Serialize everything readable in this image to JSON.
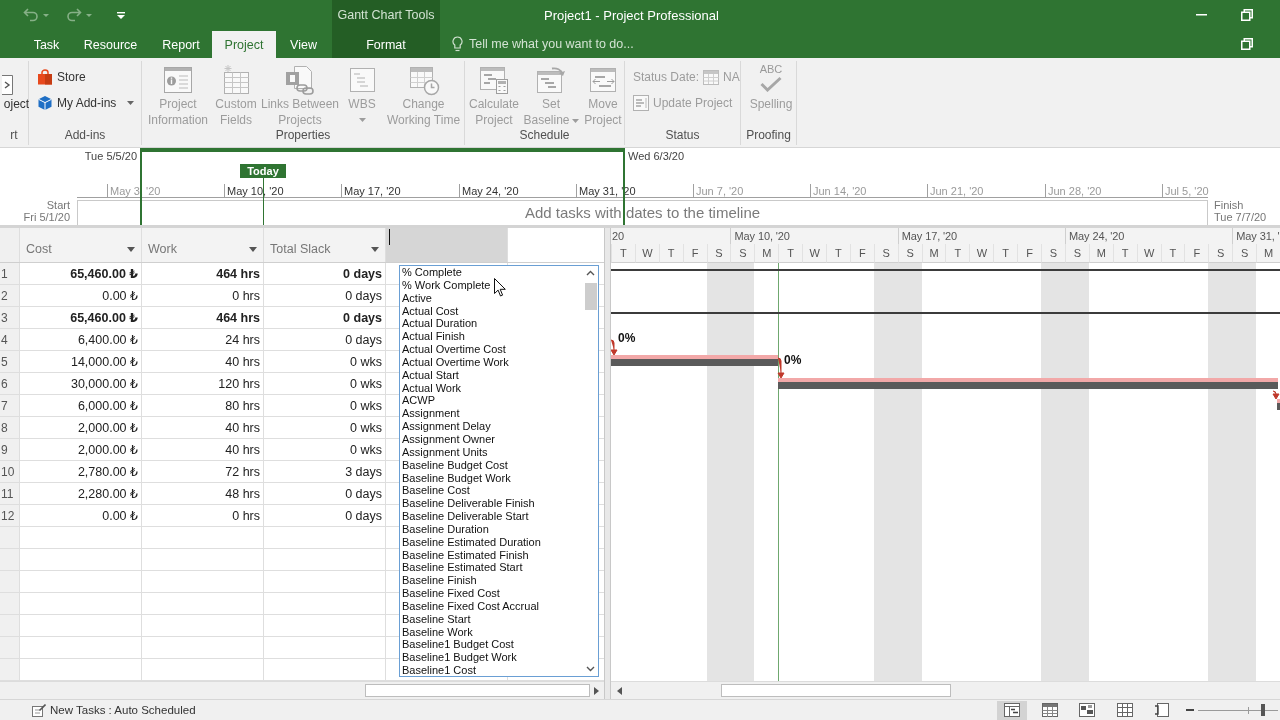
{
  "header": {
    "title": "Project1 - Project Professional",
    "context_group": "Gantt Chart Tools",
    "tabs": [
      {
        "label": "Task",
        "kind": "standard",
        "selected": false
      },
      {
        "label": "Resource",
        "kind": "standard",
        "selected": false
      },
      {
        "label": "Report",
        "kind": "standard",
        "selected": false
      },
      {
        "label": "Project",
        "kind": "standard",
        "selected": true
      },
      {
        "label": "View",
        "kind": "standard",
        "selected": false
      },
      {
        "label": "Format",
        "kind": "contextual",
        "selected": false
      }
    ],
    "tell_me": {
      "placeholder": "Tell me what you want to do..."
    }
  },
  "ribbon": {
    "groups": [
      {
        "label": "rt",
        "buttons": [
          {
            "kind": "large",
            "label": "oject",
            "disabled": false
          }
        ]
      },
      {
        "label": "Add-ins",
        "buttons": [
          {
            "kind": "small",
            "label": "Store",
            "disabled": false,
            "has_menu": false
          },
          {
            "kind": "small",
            "label": "My Add-ins",
            "disabled": false,
            "has_menu": true
          }
        ]
      },
      {
        "label": "Properties",
        "buttons": [
          {
            "kind": "large",
            "label": "Project\nInformation",
            "disabled": true,
            "has_menu": false
          },
          {
            "kind": "large",
            "label": "Custom\nFields",
            "disabled": true,
            "has_menu": false
          },
          {
            "kind": "large",
            "label": "Links Between\nProjects",
            "disabled": true,
            "has_menu": false
          },
          {
            "kind": "large",
            "label": "WBS",
            "disabled": true,
            "has_menu": true
          },
          {
            "kind": "large",
            "label": "Change\nWorking Time",
            "disabled": true,
            "has_menu": false
          }
        ]
      },
      {
        "label": "Schedule",
        "buttons": [
          {
            "kind": "large",
            "label": "Calculate\nProject",
            "disabled": true,
            "has_menu": false
          },
          {
            "kind": "large",
            "label": "Set\nBaseline",
            "disabled": true,
            "has_menu": true
          },
          {
            "kind": "large",
            "label": "Move\nProject",
            "disabled": true,
            "has_menu": false
          }
        ]
      },
      {
        "label": "Status",
        "buttons": [
          {
            "kind": "date",
            "label": "Status Date:",
            "value": "NA",
            "disabled": true
          },
          {
            "kind": "small",
            "label": "Update Project",
            "disabled": true
          }
        ]
      },
      {
        "label": "Proofing",
        "buttons": [
          {
            "kind": "large",
            "label": "Spelling",
            "icon_text": "ABC",
            "disabled": true
          }
        ]
      }
    ]
  },
  "timeline": {
    "range_start": "Tue 5/5/20",
    "range_end": "Wed 6/3/20",
    "today_label": "Today",
    "ticks": [
      "May 3, '20",
      "May 10, '20",
      "May 17, '20",
      "May 24, '20",
      "May 31, '20",
      "Jun 7, '20",
      "Jun 14, '20",
      "Jun 21, '20",
      "Jun 28, '20",
      "Jul 5, '20"
    ],
    "start": {
      "label": "Start",
      "date": "Fri 5/1/20"
    },
    "finish": {
      "label": "Finish",
      "date": "Tue 7/7/20"
    },
    "empty_message": "Add tasks with dates to the timeline"
  },
  "table": {
    "columns": [
      {
        "label": "Cost"
      },
      {
        "label": "Work"
      },
      {
        "label": "Total Slack"
      }
    ],
    "new_column": {
      "editing": true
    },
    "rows": [
      {
        "id": "1",
        "summary": true,
        "cells": [
          "65,460.00 ₺",
          "464 hrs",
          "0 days"
        ]
      },
      {
        "id": "2",
        "summary": false,
        "cells": [
          "0.00 ₺",
          "0 hrs",
          "0 days"
        ]
      },
      {
        "id": "3",
        "summary": true,
        "cells": [
          "65,460.00 ₺",
          "464 hrs",
          "0 days"
        ]
      },
      {
        "id": "4",
        "summary": false,
        "cells": [
          "6,400.00 ₺",
          "24 hrs",
          "0 days"
        ]
      },
      {
        "id": "5",
        "summary": false,
        "cells": [
          "14,000.00 ₺",
          "40 hrs",
          "0 wks"
        ]
      },
      {
        "id": "6",
        "summary": false,
        "cells": [
          "30,000.00 ₺",
          "120 hrs",
          "0 wks"
        ]
      },
      {
        "id": "7",
        "summary": false,
        "cells": [
          "6,000.00 ₺",
          "80 hrs",
          "0 wks"
        ]
      },
      {
        "id": "8",
        "summary": false,
        "cells": [
          "2,000.00 ₺",
          "40 hrs",
          "0 wks"
        ]
      },
      {
        "id": "9",
        "summary": false,
        "cells": [
          "2,000.00 ₺",
          "40 hrs",
          "0 wks"
        ]
      },
      {
        "id": "10",
        "summary": false,
        "cells": [
          "2,780.00 ₺",
          "72 hrs",
          "3 days"
        ]
      },
      {
        "id": "11",
        "summary": false,
        "cells": [
          "2,280.00 ₺",
          "48 hrs",
          "0 days"
        ]
      },
      {
        "id": "12",
        "summary": false,
        "cells": [
          "0.00 ₺",
          "0 hrs",
          "0 days"
        ]
      }
    ]
  },
  "field_list": {
    "items": [
      "% Complete",
      "% Work Complete",
      "Active",
      "Actual Cost",
      "Actual Duration",
      "Actual Finish",
      "Actual Overtime Cost",
      "Actual Overtime Work",
      "Actual Start",
      "Actual Work",
      "ACWP",
      "Assignment",
      "Assignment Delay",
      "Assignment Owner",
      "Assignment Units",
      "Baseline Budget Cost",
      "Baseline Budget Work",
      "Baseline Cost",
      "Baseline Deliverable Finish",
      "Baseline Deliverable Start",
      "Baseline Duration",
      "Baseline Estimated Duration",
      "Baseline Estimated Finish",
      "Baseline Estimated Start",
      "Baseline Finish",
      "Baseline Fixed Cost",
      "Baseline Fixed Cost Accrual",
      "Baseline Start",
      "Baseline Work",
      "Baseline1 Budget Cost",
      "Baseline1 Budget Work",
      "Baseline1 Cost"
    ]
  },
  "gantt": {
    "weeks": [
      "20",
      "May 10, '20",
      "May 17, '20",
      "May 24, '20",
      "May 31, '"
    ],
    "days": [
      {
        "letter": "T",
        "weekend": false,
        "today": false
      },
      {
        "letter": "W",
        "weekend": false,
        "today": false
      },
      {
        "letter": "T",
        "weekend": false,
        "today": false
      },
      {
        "letter": "F",
        "weekend": false,
        "today": false
      },
      {
        "letter": "S",
        "weekend": true,
        "today": false
      },
      {
        "letter": "S",
        "weekend": true,
        "today": false
      },
      {
        "letter": "M",
        "weekend": false,
        "today": false
      },
      {
        "letter": "T",
        "weekend": false,
        "today": true
      },
      {
        "letter": "W",
        "weekend": false,
        "today": false
      },
      {
        "letter": "T",
        "weekend": false,
        "today": false
      },
      {
        "letter": "F",
        "weekend": false,
        "today": false
      },
      {
        "letter": "S",
        "weekend": true,
        "today": false
      },
      {
        "letter": "S",
        "weekend": true,
        "today": false
      },
      {
        "letter": "M",
        "weekend": false,
        "today": false
      },
      {
        "letter": "T",
        "weekend": false,
        "today": false
      },
      {
        "letter": "W",
        "weekend": false,
        "today": false
      },
      {
        "letter": "T",
        "weekend": false,
        "today": false
      },
      {
        "letter": "F",
        "weekend": false,
        "today": false
      },
      {
        "letter": "S",
        "weekend": true,
        "today": false
      },
      {
        "letter": "S",
        "weekend": true,
        "today": false
      },
      {
        "letter": "M",
        "weekend": false,
        "today": false
      },
      {
        "letter": "T",
        "weekend": false,
        "today": false
      },
      {
        "letter": "W",
        "weekend": false,
        "today": false
      },
      {
        "letter": "T",
        "weekend": false,
        "today": false
      },
      {
        "letter": "F",
        "weekend": false,
        "today": false
      },
      {
        "letter": "S",
        "weekend": true,
        "today": false
      },
      {
        "letter": "S",
        "weekend": true,
        "today": false
      },
      {
        "letter": "M",
        "weekend": false,
        "today": false
      }
    ],
    "bars": [
      {
        "kind": "summary"
      },
      {
        "kind": "summary"
      },
      {
        "kind": "task",
        "label": "0%"
      },
      {
        "kind": "task",
        "label": "0%"
      },
      {
        "kind": "task"
      }
    ]
  },
  "status_bar": {
    "message": "New Tasks : Auto Scheduled",
    "views": [
      {
        "selected": true
      },
      {
        "selected": false
      },
      {
        "selected": false
      },
      {
        "selected": false
      },
      {
        "selected": false
      }
    ],
    "zoom": {
      "level": 0.81
    }
  }
}
